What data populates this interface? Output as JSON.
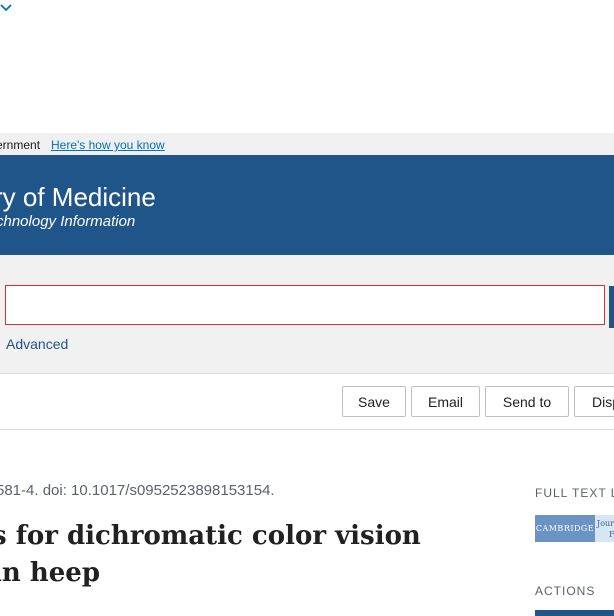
{
  "gov_banner": {
    "text": "ernment",
    "link": "Here's how you know"
  },
  "header": {
    "title": "ry of Medicine",
    "subtitle": "chnology Information"
  },
  "search": {
    "value": "",
    "advanced_label": "Advanced"
  },
  "toolbar": {
    "buttons": [
      {
        "label": "Save"
      },
      {
        "label": "Email"
      },
      {
        "label": "Send to"
      },
      {
        "label": "Disp"
      }
    ]
  },
  "article": {
    "citation": "581-4. doi: 10.1017/s0952523898153154.",
    "title": "s for dichromatic color vision in heep"
  },
  "sidebar": {
    "full_text_label": "FULL TEXT LIN",
    "logo": {
      "name": "CAMBRIDGE",
      "extra_line1": "Journ",
      "extra_line2": "F"
    },
    "actions_label": "ACTIONS"
  }
}
